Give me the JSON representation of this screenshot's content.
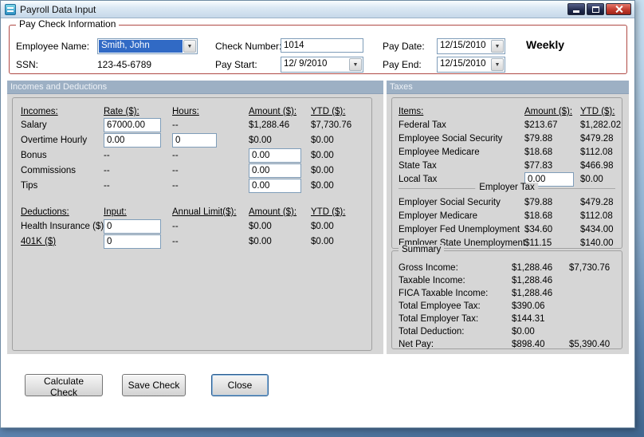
{
  "titlebar": {
    "title": "Payroll Data Input"
  },
  "glyphs": {
    "dropdown_arrow": "▼"
  },
  "colors": {
    "group_border_red": "#b04a45",
    "section_header_bg": "#9db0c4",
    "panel_gray": "#d6d6d6",
    "selection_blue": "#316ac5",
    "close_button_red": "#c23b2e"
  },
  "payinfo": {
    "legend": "Pay Check Information",
    "labels": {
      "employee": "Employee Name:",
      "ssn": "SSN:",
      "check": "Check Number:",
      "paystart": "Pay Start:",
      "paydate": "Pay Date:",
      "payend": "Pay End:"
    },
    "values": {
      "employee": "Smith, John",
      "ssn": "123-45-6789",
      "check": "1014",
      "paystart": "12/ 9/2010",
      "paydate": "12/15/2010",
      "payend": "12/15/2010",
      "frequency": "Weekly"
    }
  },
  "left": {
    "header": "Incomes and Deductions",
    "incomes_headers": {
      "item": "Incomes:",
      "rate": "Rate ($):",
      "hours": "Hours:",
      "amount": "Amount ($):",
      "ytd": "YTD ($):"
    },
    "incomes": [
      {
        "label": "Salary",
        "rate": "67000.00",
        "hours": "--",
        "amount": "$1,288.46",
        "ytd": "$7,730.76"
      },
      {
        "label": "Overtime Hourly",
        "rate": "0.00",
        "hours": "0",
        "amount": "$0.00",
        "ytd": "$0.00"
      },
      {
        "label": "Bonus",
        "rate": "--",
        "hours": "--",
        "amount": "0.00",
        "ytd": "$0.00"
      },
      {
        "label": "Commissions",
        "rate": "--",
        "hours": "--",
        "amount": "0.00",
        "ytd": "$0.00"
      },
      {
        "label": "Tips",
        "rate": "--",
        "hours": "--",
        "amount": "0.00",
        "ytd": "$0.00"
      }
    ],
    "deductions_headers": {
      "item": "Deductions:",
      "input": "Input:",
      "limit": "Annual Limit($):",
      "amount": "Amount ($):",
      "ytd": "YTD ($):"
    },
    "deductions": [
      {
        "label": "Health Insurance ($)",
        "input": "0",
        "limit": "--",
        "amount": "$0.00",
        "ytd": "$0.00"
      },
      {
        "label": "401K ($)",
        "input": "0",
        "limit": "--",
        "amount": "$0.00",
        "ytd": "$0.00"
      }
    ]
  },
  "taxes": {
    "header": "Taxes",
    "headers": {
      "item": "Items:",
      "amount": "Amount ($):",
      "ytd": "YTD ($):"
    },
    "employee_rows": [
      {
        "label": "Federal Tax",
        "amount": "$213.67",
        "ytd": "$1,282.02"
      },
      {
        "label": "Employee Social Security",
        "amount": "$79.88",
        "ytd": "$479.28"
      },
      {
        "label": "Employee Medicare",
        "amount": "$18.68",
        "ytd": "$112.08"
      },
      {
        "label": "State Tax",
        "amount": "$77.83",
        "ytd": "$466.98"
      },
      {
        "label": "Local Tax",
        "amount": "0.00",
        "ytd": "$0.00"
      }
    ],
    "employer_label": "Employer Tax",
    "employer_rows": [
      {
        "label": "Employer Social Security",
        "amount": "$79.88",
        "ytd": "$479.28"
      },
      {
        "label": "Employer Medicare",
        "amount": "$18.68",
        "ytd": "$112.08"
      },
      {
        "label": "Employer Fed Unemployment",
        "amount": "$34.60",
        "ytd": "$434.00"
      },
      {
        "label": "Employer State Unemployment",
        "amount": "$11.15",
        "ytd": "$140.00"
      }
    ]
  },
  "summary": {
    "legend": "Summary",
    "rows": [
      {
        "label": "Gross Income:",
        "amount": "$1,288.46",
        "ytd": "$7,730.76"
      },
      {
        "label": "Taxable Income:",
        "amount": "$1,288.46",
        "ytd": ""
      },
      {
        "label": "FICA Taxable Income:",
        "amount": "$1,288.46",
        "ytd": ""
      },
      {
        "label": "Total Employee Tax:",
        "amount": "$390.06",
        "ytd": ""
      },
      {
        "label": "Total Employer Tax:",
        "amount": "$144.31",
        "ytd": ""
      },
      {
        "label": "Total Deduction:",
        "amount": "$0.00",
        "ytd": ""
      },
      {
        "label": "Net Pay:",
        "amount": "$898.40",
        "ytd": "$5,390.40"
      }
    ]
  },
  "buttons": {
    "calculate": "Calculate Check",
    "save": "Save Check",
    "close": "Close"
  }
}
